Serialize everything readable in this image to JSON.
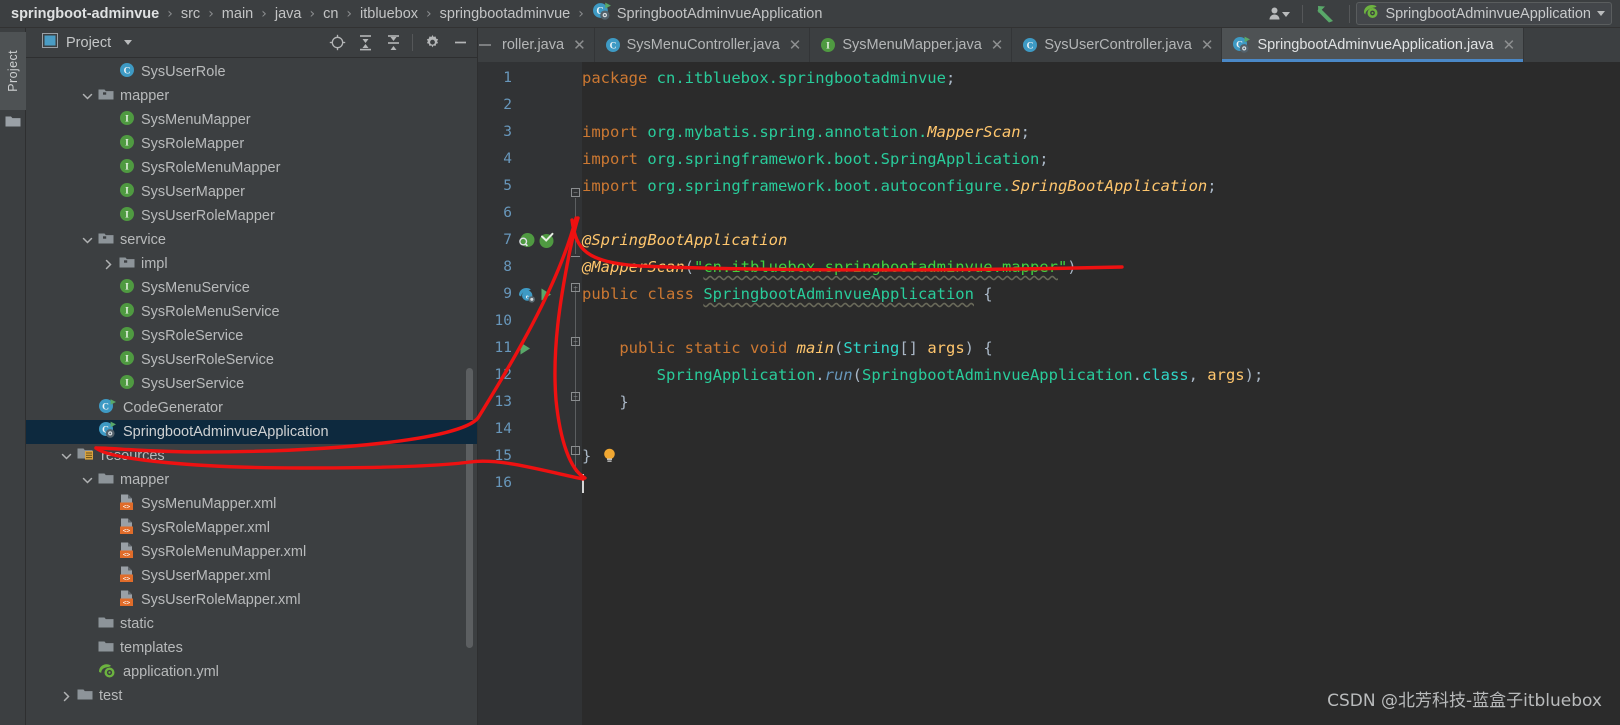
{
  "breadcrumb": {
    "items": [
      {
        "label": "springboot-adminvue",
        "icon": "",
        "root": true
      },
      {
        "label": "src",
        "icon": ""
      },
      {
        "label": "main",
        "icon": ""
      },
      {
        "label": "java",
        "icon": ""
      },
      {
        "label": "cn",
        "icon": ""
      },
      {
        "label": "itbluebox",
        "icon": ""
      },
      {
        "label": "springbootadminvue",
        "icon": ""
      },
      {
        "label": "SpringbootAdminvueApplication",
        "icon": "spring-boot-class-icon"
      }
    ],
    "separator": "›"
  },
  "topbar_right": {
    "user_icon": "user-dropdown-icon",
    "run_arrow_icon": "green-arrow-icon",
    "run_config": {
      "icon": "spring-boot-config-icon",
      "label": "SpringbootAdminvueApplication",
      "caret": "chevron-down-icon"
    }
  },
  "left_strip": {
    "tool_window_label": "Project",
    "folder_icon": "folder-icon"
  },
  "project_panel": {
    "header": {
      "icon": "project-view-icon",
      "title": "Project",
      "caret": "chevron-down-icon",
      "actions": [
        {
          "name": "locate-icon"
        },
        {
          "name": "expand-all-icon"
        },
        {
          "name": "collapse-all-icon"
        },
        {
          "name": "gear-icon"
        },
        {
          "name": "minimize-icon"
        }
      ]
    },
    "tree": [
      {
        "label": "SysUserRole",
        "indent": 5,
        "icon": "class-icon",
        "arrow": "none",
        "selected": false
      },
      {
        "label": "mapper",
        "indent": 4,
        "icon": "package-icon",
        "arrow": "down",
        "selected": false
      },
      {
        "label": "SysMenuMapper",
        "indent": 5,
        "icon": "interface-icon",
        "arrow": "none",
        "selected": false
      },
      {
        "label": "SysRoleMapper",
        "indent": 5,
        "icon": "interface-icon",
        "arrow": "none",
        "selected": false
      },
      {
        "label": "SysRoleMenuMapper",
        "indent": 5,
        "icon": "interface-icon",
        "arrow": "none",
        "selected": false
      },
      {
        "label": "SysUserMapper",
        "indent": 5,
        "icon": "interface-icon",
        "arrow": "none",
        "selected": false
      },
      {
        "label": "SysUserRoleMapper",
        "indent": 5,
        "icon": "interface-icon",
        "arrow": "none",
        "selected": false
      },
      {
        "label": "service",
        "indent": 4,
        "icon": "package-icon",
        "arrow": "down",
        "selected": false
      },
      {
        "label": "impl",
        "indent": 5,
        "icon": "package-icon",
        "arrow": "right",
        "selected": false
      },
      {
        "label": "SysMenuService",
        "indent": 5,
        "icon": "interface-icon",
        "arrow": "none",
        "selected": false
      },
      {
        "label": "SysRoleMenuService",
        "indent": 5,
        "icon": "interface-icon",
        "arrow": "none",
        "selected": false
      },
      {
        "label": "SysRoleService",
        "indent": 5,
        "icon": "interface-icon",
        "arrow": "none",
        "selected": false
      },
      {
        "label": "SysUserRoleService",
        "indent": 5,
        "icon": "interface-icon",
        "arrow": "none",
        "selected": false
      },
      {
        "label": "SysUserService",
        "indent": 5,
        "icon": "interface-icon",
        "arrow": "none",
        "selected": false
      },
      {
        "label": "CodeGenerator",
        "indent": 4,
        "icon": "runnable-class-icon",
        "arrow": "none",
        "selected": false
      },
      {
        "label": "SpringbootAdminvueApplication",
        "indent": 4,
        "icon": "spring-boot-class-icon",
        "arrow": "none",
        "selected": true
      },
      {
        "label": "resources",
        "indent": 3,
        "icon": "resources-folder-icon",
        "arrow": "down",
        "selected": false
      },
      {
        "label": "mapper",
        "indent": 4,
        "icon": "folder-icon",
        "arrow": "down",
        "selected": false
      },
      {
        "label": "SysMenuMapper.xml",
        "indent": 5,
        "icon": "xml-file-icon",
        "arrow": "none",
        "selected": false
      },
      {
        "label": "SysRoleMapper.xml",
        "indent": 5,
        "icon": "xml-file-icon",
        "arrow": "none",
        "selected": false
      },
      {
        "label": "SysRoleMenuMapper.xml",
        "indent": 5,
        "icon": "xml-file-icon",
        "arrow": "none",
        "selected": false
      },
      {
        "label": "SysUserMapper.xml",
        "indent": 5,
        "icon": "xml-file-icon",
        "arrow": "none",
        "selected": false
      },
      {
        "label": "SysUserRoleMapper.xml",
        "indent": 5,
        "icon": "xml-file-icon",
        "arrow": "none",
        "selected": false
      },
      {
        "label": "static",
        "indent": 4,
        "icon": "folder-icon",
        "arrow": "none",
        "selected": false
      },
      {
        "label": "templates",
        "indent": 4,
        "icon": "folder-icon",
        "arrow": "none",
        "selected": false
      },
      {
        "label": "application.yml",
        "indent": 4,
        "icon": "spring-yaml-icon",
        "arrow": "none",
        "selected": false
      },
      {
        "label": "test",
        "indent": 3,
        "icon": "folder-icon",
        "arrow": "right",
        "selected": false
      }
    ]
  },
  "editor_tabs": [
    {
      "label": "roller.java",
      "icon": "none",
      "active": false,
      "clipped": true
    },
    {
      "label": "SysMenuController.java",
      "icon": "class-icon",
      "active": false
    },
    {
      "label": "SysMenuMapper.java",
      "icon": "interface-icon",
      "active": false
    },
    {
      "label": "SysUserController.java",
      "icon": "class-icon",
      "active": false
    },
    {
      "label": "SpringbootAdminvueApplication.java",
      "icon": "spring-boot-class-icon",
      "active": true
    }
  ],
  "editor": {
    "filename": "SpringbootAdminvueApplication.java",
    "language": "java",
    "line_numbers": [
      1,
      2,
      3,
      4,
      5,
      6,
      7,
      8,
      9,
      10,
      11,
      12,
      13,
      14,
      15,
      16
    ],
    "cursor_line": 16,
    "lines": [
      {
        "n": 1,
        "text": "package cn.itbluebox.springbootadminvue;"
      },
      {
        "n": 2,
        "text": ""
      },
      {
        "n": 3,
        "text": "import org.mybatis.spring.annotation.MapperScan;"
      },
      {
        "n": 4,
        "text": "import org.springframework.boot.SpringApplication;"
      },
      {
        "n": 5,
        "text": "import org.springframework.boot.autoconfigure.SpringBootApplication;"
      },
      {
        "n": 6,
        "text": ""
      },
      {
        "n": 7,
        "text": "@SpringBootApplication"
      },
      {
        "n": 8,
        "text": "@MapperScan(\"cn.itbluebox.springbootadminvue.mapper\")"
      },
      {
        "n": 9,
        "text": "public class SpringbootAdminvueApplication {"
      },
      {
        "n": 10,
        "text": ""
      },
      {
        "n": 11,
        "text": "    public static void main(String[] args) {"
      },
      {
        "n": 12,
        "text": "        SpringApplication.run(SpringbootAdminvueApplication.class, args);"
      },
      {
        "n": 13,
        "text": "    }"
      },
      {
        "n": 14,
        "text": ""
      },
      {
        "n": 15,
        "text": "}"
      },
      {
        "n": 16,
        "text": ""
      }
    ],
    "gutter_icons": [
      {
        "line": 7,
        "icons": [
          "spring-search-bean-icon",
          "spring-check-bean-icon"
        ]
      },
      {
        "line": 9,
        "icons": [
          "spring-bean-icon",
          "run-arrow-icon"
        ]
      },
      {
        "line": 11,
        "icons": [
          "run-arrow-icon"
        ]
      }
    ],
    "inline_icons": [
      {
        "line": 15,
        "icon": "lightbulb-icon"
      }
    ]
  },
  "annotation": {
    "type": "red-pen-marks",
    "color": "#ee1111"
  },
  "watermark": {
    "text": "CSDN @北芳科技-蓝盒子itbluebox"
  },
  "colors": {
    "background": "#3c3f41",
    "editor_background": "#2b2b2b",
    "gutter": "#313335",
    "selection": "#0d293e",
    "accent": "#4a88c7",
    "keyword": "#cc7832",
    "string": "#3fd33f",
    "annotation": "#ffc66d",
    "class_icon": "#41a3c4",
    "interface_icon": "#4f9a41",
    "xml_icon": "#e06c2a"
  }
}
